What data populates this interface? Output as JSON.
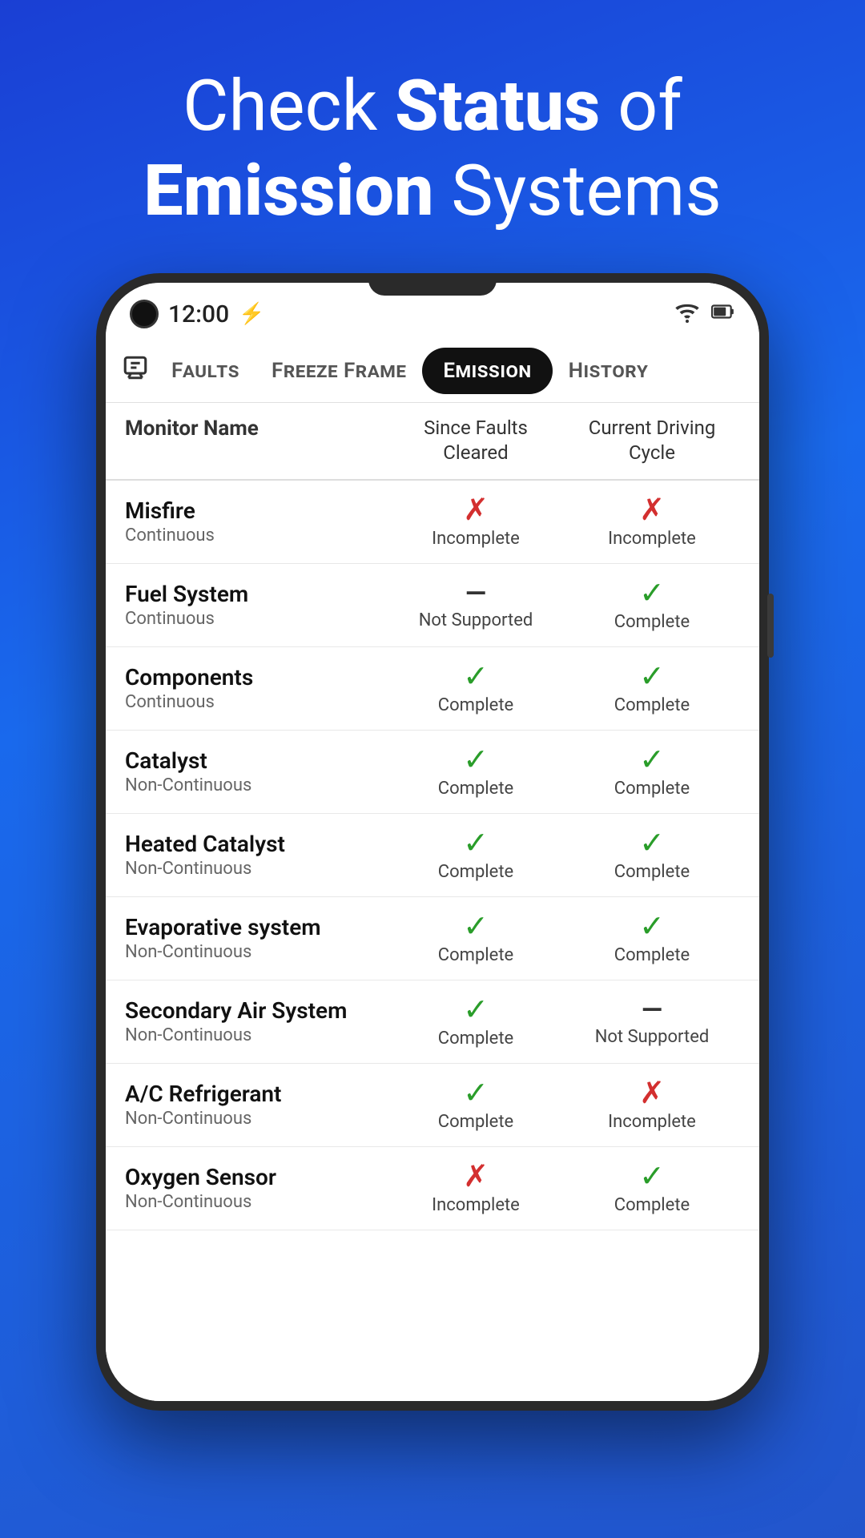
{
  "hero": {
    "line1": "Check ",
    "bold1": "Status",
    "line1b": " of",
    "line2bold": "Emission",
    "line2": " Systems"
  },
  "status_bar": {
    "time": "12:00",
    "wifi": "wifi",
    "battery": "battery"
  },
  "nav": {
    "icon": "⚙",
    "tabs": [
      {
        "label": "Faults",
        "active": false
      },
      {
        "label": "Freeze Frame",
        "active": false
      },
      {
        "label": "Emission",
        "active": true
      },
      {
        "label": "History",
        "active": false
      }
    ]
  },
  "table": {
    "headers": {
      "monitor": "Monitor Name",
      "since": "Since Faults Cleared",
      "current": "Current Driving Cycle"
    },
    "rows": [
      {
        "name": "Misfire",
        "type": "Continuous",
        "since_status": "incomplete",
        "since_icon": "✗",
        "since_label": "Incomplete",
        "current_status": "incomplete",
        "current_icon": "✗",
        "current_label": "Incomplete"
      },
      {
        "name": "Fuel System",
        "type": "Continuous",
        "since_status": "not-supported",
        "since_icon": "—",
        "since_label": "Not Supported",
        "current_status": "complete",
        "current_icon": "✓",
        "current_label": "Complete"
      },
      {
        "name": "Components",
        "type": "Continuous",
        "since_status": "complete",
        "since_icon": "✓",
        "since_label": "Complete",
        "current_status": "complete",
        "current_icon": "✓",
        "current_label": "Complete"
      },
      {
        "name": "Catalyst",
        "type": "Non-Continuous",
        "since_status": "complete",
        "since_icon": "✓",
        "since_label": "Complete",
        "current_status": "complete",
        "current_icon": "✓",
        "current_label": "Complete"
      },
      {
        "name": "Heated Catalyst",
        "type": "Non-Continuous",
        "since_status": "complete",
        "since_icon": "✓",
        "since_label": "Complete",
        "current_status": "complete",
        "current_icon": "✓",
        "current_label": "Complete"
      },
      {
        "name": "Evaporative system",
        "type": "Non-Continuous",
        "since_status": "complete",
        "since_icon": "✓",
        "since_label": "Complete",
        "current_status": "complete",
        "current_icon": "✓",
        "current_label": "Complete"
      },
      {
        "name": "Secondary Air System",
        "type": "Non-Continuous",
        "since_status": "complete",
        "since_icon": "✓",
        "since_label": "Complete",
        "current_status": "not-supported",
        "current_icon": "—",
        "current_label": "Not Supported"
      },
      {
        "name": "A/C Refrigerant",
        "type": "Non-Continuous",
        "since_status": "complete",
        "since_icon": "✓",
        "since_label": "Complete",
        "current_status": "incomplete",
        "current_icon": "✗",
        "current_label": "Incomplete"
      },
      {
        "name": "Oxygen Sensor",
        "type": "Non-Continuous",
        "since_status": "incomplete",
        "since_icon": "✗",
        "since_label": "Incomplete",
        "current_status": "complete",
        "current_icon": "✓",
        "current_label": "Complete"
      }
    ]
  }
}
